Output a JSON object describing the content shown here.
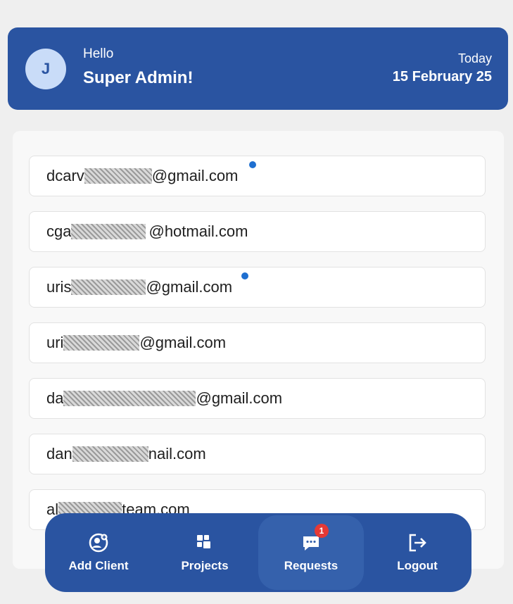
{
  "header": {
    "avatar_initial": "J",
    "greeting": "Hello",
    "user_name": "Super Admin!",
    "today_label": "Today",
    "date": "15 February 25"
  },
  "clients": [
    {
      "prefix": "dcarv",
      "suffix": "@gmail.com",
      "unread": true
    },
    {
      "prefix": "cga",
      "suffix": "@hotmail.com",
      "unread": false
    },
    {
      "prefix": "uris",
      "suffix": "@gmail.com",
      "unread": true
    },
    {
      "prefix": "uri",
      "suffix": "@gmail.com",
      "unread": false
    },
    {
      "prefix": "da",
      "suffix": "@gmail.com",
      "unread": false
    },
    {
      "prefix": "dan",
      "suffix": "nail.com",
      "unread": false
    },
    {
      "prefix": "al",
      "suffix": "team.com",
      "unread": false
    }
  ],
  "nav": {
    "add_client": "Add Client",
    "projects": "Projects",
    "requests": "Requests",
    "requests_badge": "1",
    "logout": "Logout",
    "active": "requests"
  },
  "colors": {
    "primary": "#2a54a1",
    "accent_dot": "#1e6fd0",
    "badge": "#e53935"
  }
}
